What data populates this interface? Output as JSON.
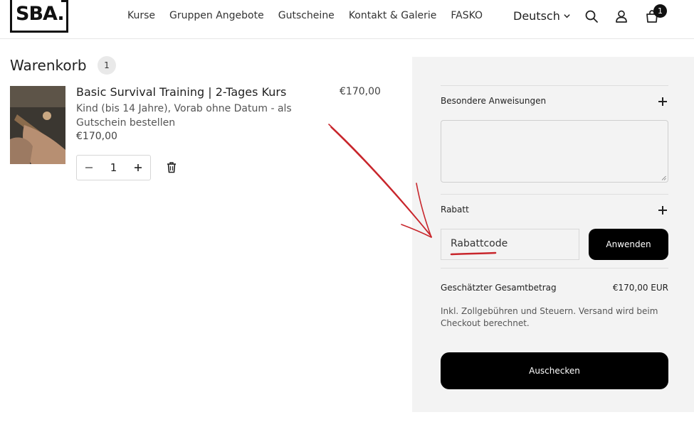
{
  "header": {
    "logo_text": "SBA.",
    "nav": [
      "Kurse",
      "Gruppen Angebote",
      "Gutscheine",
      "Kontakt & Galerie",
      "FASKO"
    ],
    "language": "Deutsch",
    "cart_count": "1",
    "icons": [
      "search-icon",
      "account-icon",
      "cart-icon",
      "chevron-down-icon"
    ]
  },
  "cart": {
    "title": "Warenkorb",
    "count": "1",
    "item": {
      "name": "Basic Survival Training | 2-Tages Kurs",
      "options": "Kind (bis 14 Jahre),  Vorab ohne Datum - als Gutschein bestellen",
      "unit_price": "€170,00",
      "line_price": "€170,00",
      "quantity": "1"
    }
  },
  "summary": {
    "instructions_label": "Besondere Anweisungen",
    "discount_label": "Rabatt",
    "coupon_placeholder": "Rabattcode",
    "apply_label": "Anwenden",
    "total_label": "Geschätzter Gesamtbetrag",
    "total_value": "€170,00 EUR",
    "tax_note": "Inkl. Zollgebühren und Steuern. Versand wird beim Checkout berechnet.",
    "checkout_label": "Auschecken"
  },
  "colors": {
    "annotation": "#c8262c",
    "button": "#000000",
    "panel": "#f3f3f3"
  }
}
